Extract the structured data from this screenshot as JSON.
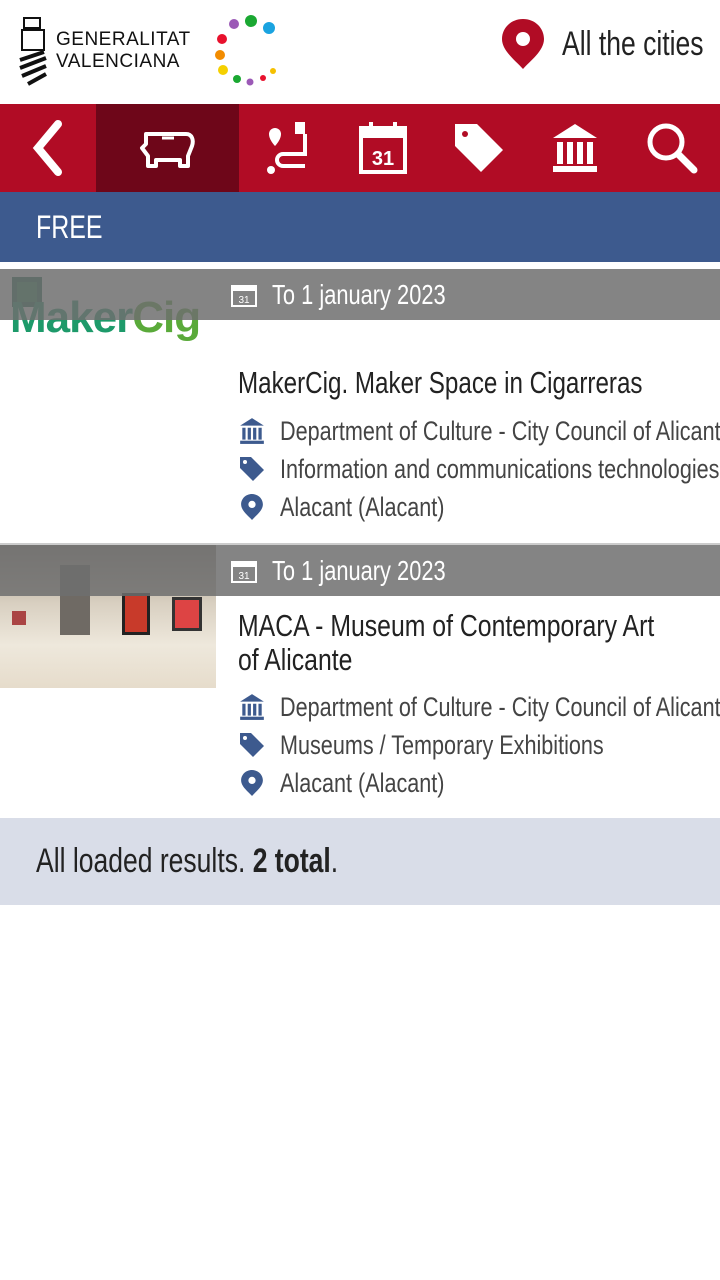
{
  "header": {
    "logo_text": [
      "GENERALITAT",
      "VALENCIANA"
    ],
    "city_selector": "All the cities"
  },
  "nav": {
    "items": [
      {
        "icon": "back-icon"
      },
      {
        "icon": "piggy-bank-icon",
        "active": true
      },
      {
        "icon": "route-icon"
      },
      {
        "icon": "calendar-icon",
        "text": "31"
      },
      {
        "icon": "tag-icon"
      },
      {
        "icon": "institution-icon"
      },
      {
        "icon": "search-icon"
      }
    ]
  },
  "filter": {
    "label": "FREE"
  },
  "results": [
    {
      "image": "MakerCig",
      "date": "To 1 january 2023",
      "title": "MakerCig. Maker Space in Cigarreras",
      "organizer": "Department of Culture - City Council of Alicante",
      "category": "Information and communications technologies",
      "location": "Alacant (Alacant)"
    },
    {
      "image": "museum gallery photo",
      "date": "To 1 january 2023",
      "title": "MACA - Museum of Contemporary Art of Alicante",
      "organizer": "Department of Culture - City Council of Alicante",
      "category": "Museums / Temporary Exhibitions",
      "location": "Alacant (Alacant)"
    }
  ],
  "footer": {
    "text": "All loaded results. ",
    "count": "2 total",
    "end": "."
  },
  "colors": {
    "red": "#b10c25",
    "active": "#6e0619",
    "blue": "#3d5a8e",
    "footer": "#d9dde8"
  }
}
